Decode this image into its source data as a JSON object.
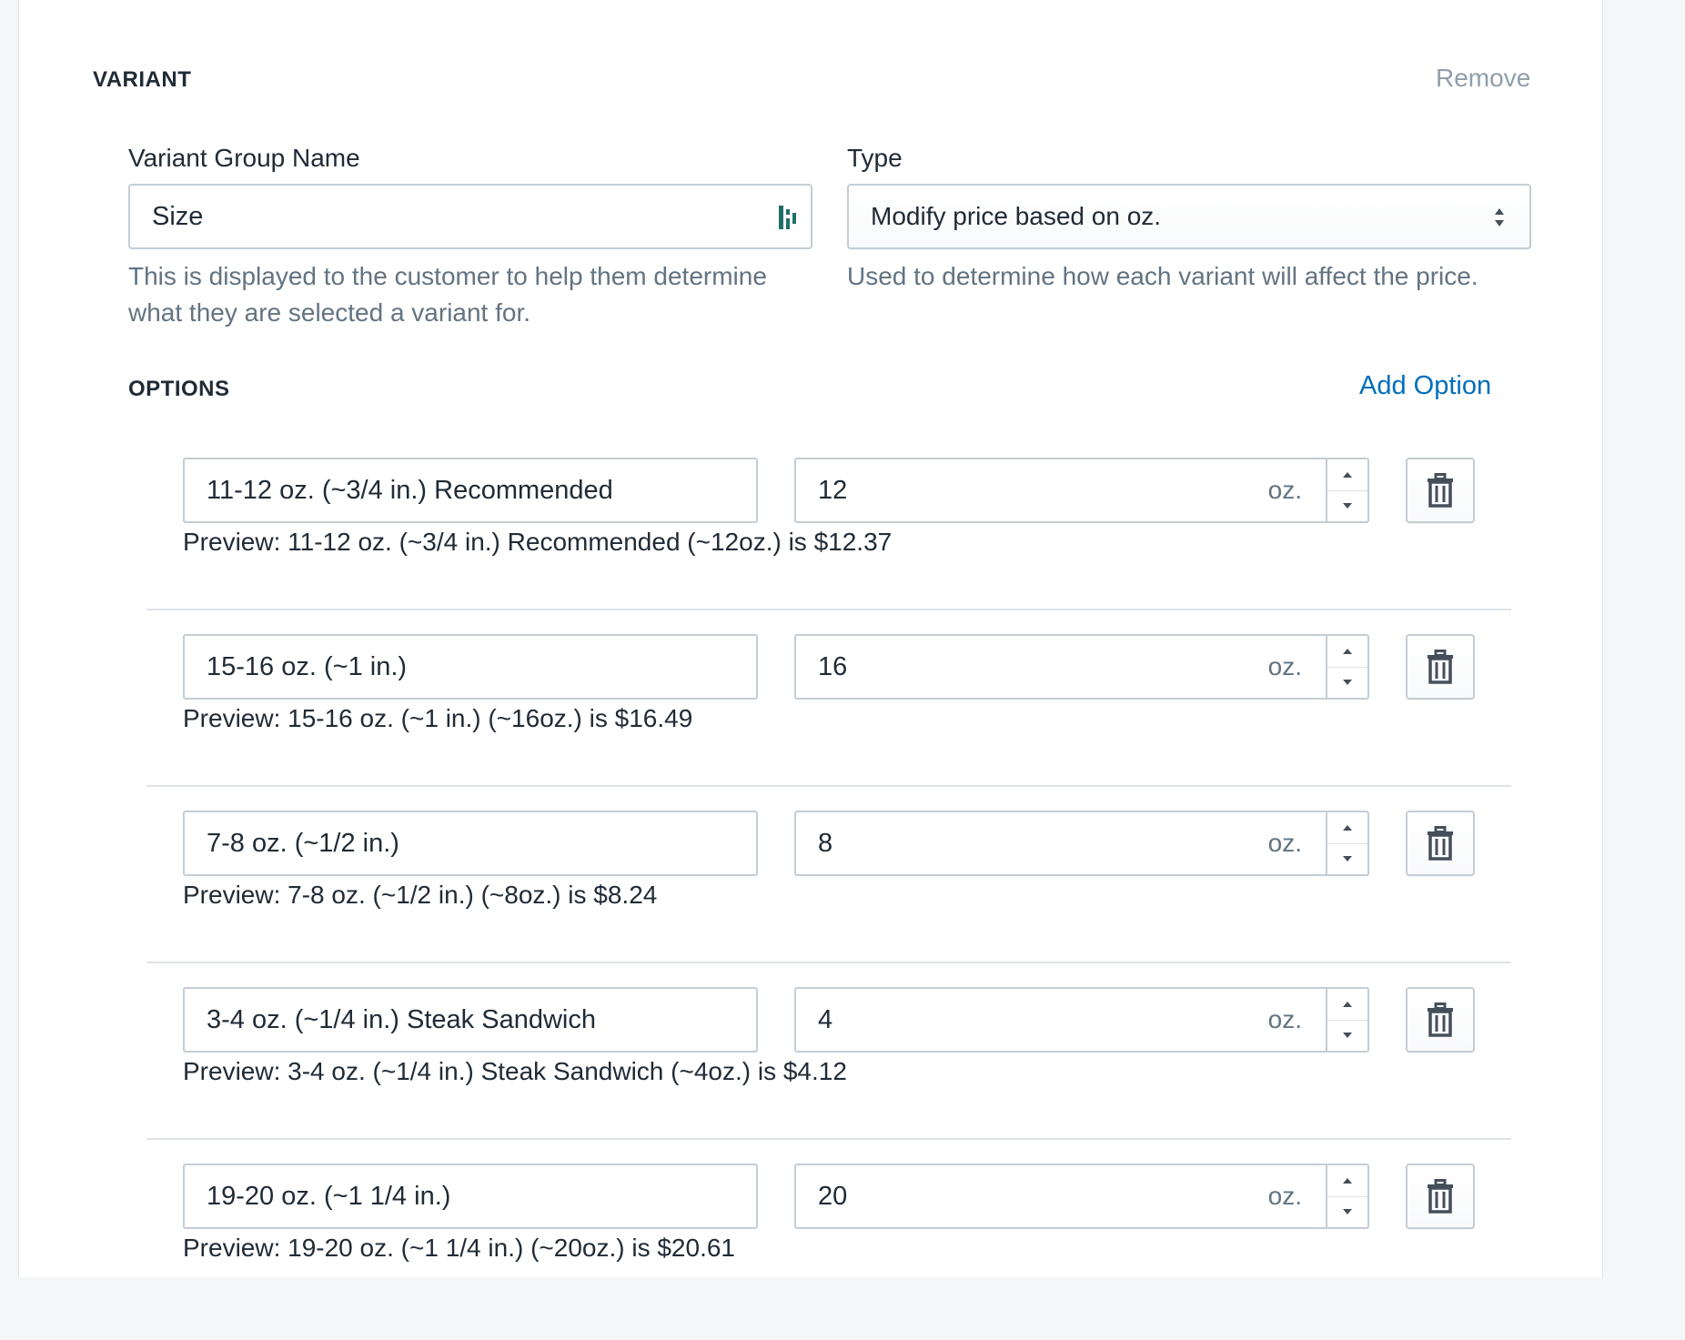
{
  "section": {
    "title": "VARIANT",
    "remove_label": "Remove"
  },
  "group_name": {
    "label": "Variant Group Name",
    "value": "Size",
    "help": "This is displayed to the customer to help them determine what they are selected a variant for."
  },
  "type": {
    "label": "Type",
    "value": "Modify price based on oz.",
    "help": "Used to determine how each variant will affect the price."
  },
  "options_section": {
    "title": "OPTIONS",
    "add_label": "Add Option"
  },
  "unit": "oz.",
  "options": [
    {
      "name": "11-12 oz. (~3/4 in.) Recommended",
      "amount": "12",
      "preview": "Preview: 11-12 oz. (~3/4 in.) Recommended (~12oz.) is $12.37"
    },
    {
      "name": "15-16 oz. (~1 in.)",
      "amount": "16",
      "preview": "Preview: 15-16 oz. (~1 in.) (~16oz.) is $16.49"
    },
    {
      "name": "7-8 oz. (~1/2 in.)",
      "amount": "8",
      "preview": "Preview: 7-8 oz. (~1/2 in.) (~8oz.) is $8.24"
    },
    {
      "name": "3-4 oz. (~1/4 in.) Steak Sandwich",
      "amount": "4",
      "preview": "Preview: 3-4 oz. (~1/4 in.) Steak Sandwich (~4oz.) is $4.12"
    },
    {
      "name": "19-20 oz. (~1 1/4 in.)",
      "amount": "20",
      "preview": "Preview: 19-20 oz. (~1 1/4 in.) (~20oz.) is $20.61"
    }
  ],
  "colors": {
    "link": "#006fbb",
    "border": "#c4cdd5",
    "muted": "#637381",
    "icon": "#454f5b"
  }
}
